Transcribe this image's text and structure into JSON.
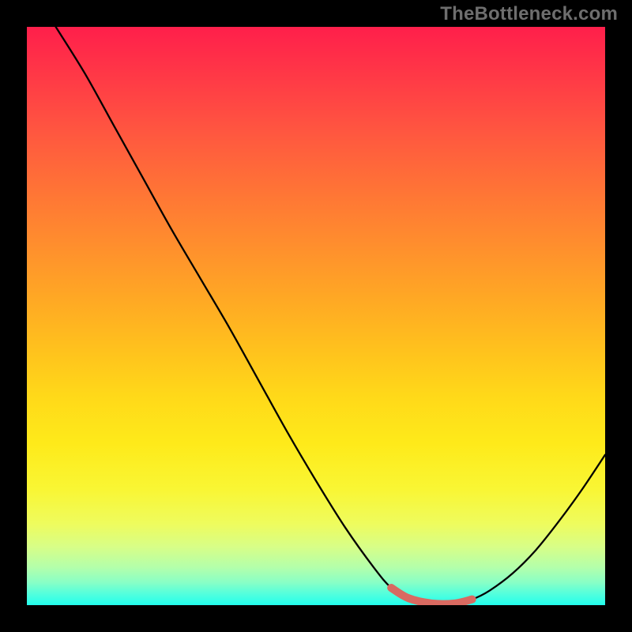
{
  "watermark": "TheBottleneck.com",
  "colors": {
    "page_bg": "#000000",
    "curve": "#000000",
    "highlight": "#d96a61",
    "watermark": "#6e6e6e"
  },
  "chart_data": {
    "type": "line",
    "title": "",
    "xlabel": "",
    "ylabel": "",
    "xlim": [
      0,
      100
    ],
    "ylim": [
      0,
      100
    ],
    "grid": false,
    "series": [
      {
        "name": "curve",
        "x": [
          5,
          10,
          15,
          20,
          25,
          30,
          35,
          40,
          45,
          50,
          55,
          60,
          63,
          66,
          70,
          74,
          77,
          80,
          84,
          88,
          92,
          96,
          100
        ],
        "y": [
          100,
          92,
          83,
          74,
          65,
          56.5,
          48,
          39,
          30,
          21.5,
          13.5,
          6.5,
          3,
          1.2,
          0.3,
          0.3,
          1,
          2.5,
          5.5,
          9.5,
          14.5,
          20,
          26
        ]
      }
    ],
    "highlight": {
      "x_start": 63,
      "x_end": 77,
      "color": "#d96a61"
    },
    "background_gradient": {
      "direction": "vertical",
      "stops": [
        {
          "pct": 0,
          "color": "#ff1f4b"
        },
        {
          "pct": 18,
          "color": "#ff5640"
        },
        {
          "pct": 38,
          "color": "#ff8f2d"
        },
        {
          "pct": 56,
          "color": "#ffc21d"
        },
        {
          "pct": 72,
          "color": "#feea1a"
        },
        {
          "pct": 86,
          "color": "#eefc5e"
        },
        {
          "pct": 93,
          "color": "#b3ffab"
        },
        {
          "pct": 100,
          "color": "#22ffed"
        }
      ]
    }
  }
}
